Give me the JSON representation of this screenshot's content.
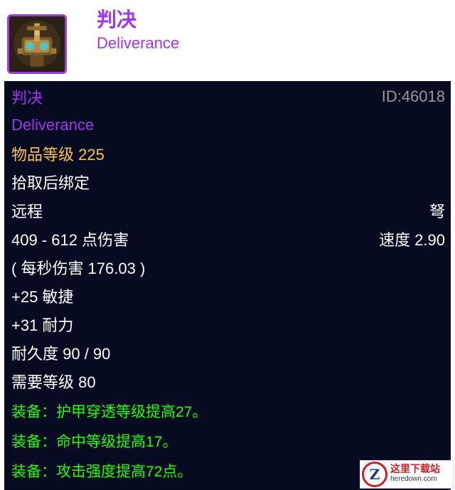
{
  "header": {
    "icon": "ornate-mechanical-crossbow-icon",
    "name_cn": "判决",
    "name_en": "Deliverance"
  },
  "tooltip": {
    "name_cn": "判决",
    "item_id": "ID:46018",
    "name_en": "Deliverance",
    "item_level": "物品等级 225",
    "binding": "拾取后绑定",
    "slot": "远程",
    "weapon_type": "弩",
    "damage": "409 - 612 点伤害",
    "speed": "速度 2.90",
    "dps": "( 每秒伤害 176.03 )",
    "agility": "+25 敏捷",
    "stamina": "+31 耐力",
    "durability": "耐久度 90 / 90",
    "required_level": "需要等级 80",
    "equip_effects": [
      "装备：护甲穿透等级提高27。",
      "装备：命中等级提高17。",
      "装备：攻击强度提高72点。"
    ]
  },
  "watermark": {
    "logo_letter": "Z",
    "title": "这里下载站",
    "url": "heredown.com"
  },
  "colors": {
    "epic": "#a335ee",
    "item_level": "#ffc14a",
    "equip_green": "#1eff00",
    "tooltip_bg": "#070b22"
  }
}
